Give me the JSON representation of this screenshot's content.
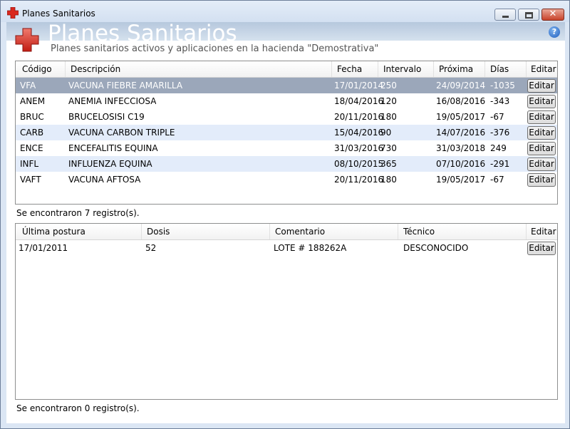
{
  "window": {
    "title": "Planes Sanitarios",
    "buttons": {
      "minimize": "minimize",
      "maximize": "maximize",
      "close": "✕"
    }
  },
  "header": {
    "title": "Planes Sanitarios",
    "subtitle": "Planes sanitarios activos y aplicaciones en la hacienda \"Demostrativa\"",
    "help": "?"
  },
  "plans": {
    "columns": [
      "Código",
      "Descripción",
      "Fecha",
      "Intervalo",
      "Próxima",
      "Días",
      "Editar"
    ],
    "rows": [
      {
        "codigo": "VFA",
        "descripcion": "VACUNA FIEBRE AMARILLA",
        "fecha": "17/01/2014",
        "intervalo": "250",
        "proxima": "24/09/2014",
        "dias": "-1035",
        "editar": "Editar"
      },
      {
        "codigo": "ANEM",
        "descripcion": "ANEMIA INFECCIOSA",
        "fecha": "18/04/2016",
        "intervalo": "120",
        "proxima": "16/08/2016",
        "dias": "-343",
        "editar": "Editar"
      },
      {
        "codigo": "BRUC",
        "descripcion": "BRUCELOSISI C19",
        "fecha": "20/11/2016",
        "intervalo": "180",
        "proxima": "19/05/2017",
        "dias": "-67",
        "editar": "Editar"
      },
      {
        "codigo": "CARB",
        "descripcion": "VACUNA CARBON TRIPLE",
        "fecha": "15/04/2016",
        "intervalo": "90",
        "proxima": "14/07/2016",
        "dias": "-376",
        "editar": "Editar"
      },
      {
        "codigo": "ENCE",
        "descripcion": "ENCEFALITIS EQUINA",
        "fecha": "31/03/2016",
        "intervalo": "730",
        "proxima": "31/03/2018",
        "dias": "249",
        "editar": "Editar"
      },
      {
        "codigo": "INFL",
        "descripcion": "INFLUENZA EQUINA",
        "fecha": "08/10/2015",
        "intervalo": "365",
        "proxima": "07/10/2016",
        "dias": "-291",
        "editar": "Editar"
      },
      {
        "codigo": "VAFT",
        "descripcion": "VACUNA AFTOSA",
        "fecha": "20/11/2016",
        "intervalo": "180",
        "proxima": "19/05/2017",
        "dias": "-67",
        "editar": "Editar"
      }
    ],
    "status": "Se encontraron 7 registro(s)."
  },
  "applications": {
    "columns": [
      "Última postura",
      "Dosis",
      "Comentario",
      "Técnico",
      "Editar"
    ],
    "rows": [
      {
        "ultima_postura": "17/01/2011",
        "dosis": "52",
        "comentario": "LOTE # 188262A",
        "tecnico": "DESCONOCIDO",
        "editar": "Editar"
      }
    ],
    "status": "Se encontraron 0 registro(s)."
  },
  "colors": {
    "selected_row": "#9ba7ba",
    "alt_row": "#e3ecfa",
    "close_button": "#c8422a"
  }
}
